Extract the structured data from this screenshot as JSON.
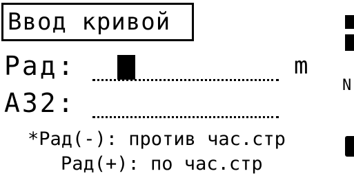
{
  "title": "Ввод кривой",
  "fields": {
    "rad": {
      "label": "Рад:",
      "unit": "m",
      "value": ""
    },
    "az": {
      "label": "АЗ2:",
      "value": ""
    }
  },
  "help": {
    "line1": "*Рад(-): против час.стр",
    "line2": "Рад(+): по час.стр"
  },
  "edge": {
    "mid_char": "N"
  },
  "colors": {
    "foreground": "#000000",
    "background": "#ffffff"
  },
  "icons": {
    "cursor": "block-cursor",
    "edge_top": "battery-level-icon",
    "edge_bottom": "softkey-tab-icon"
  }
}
